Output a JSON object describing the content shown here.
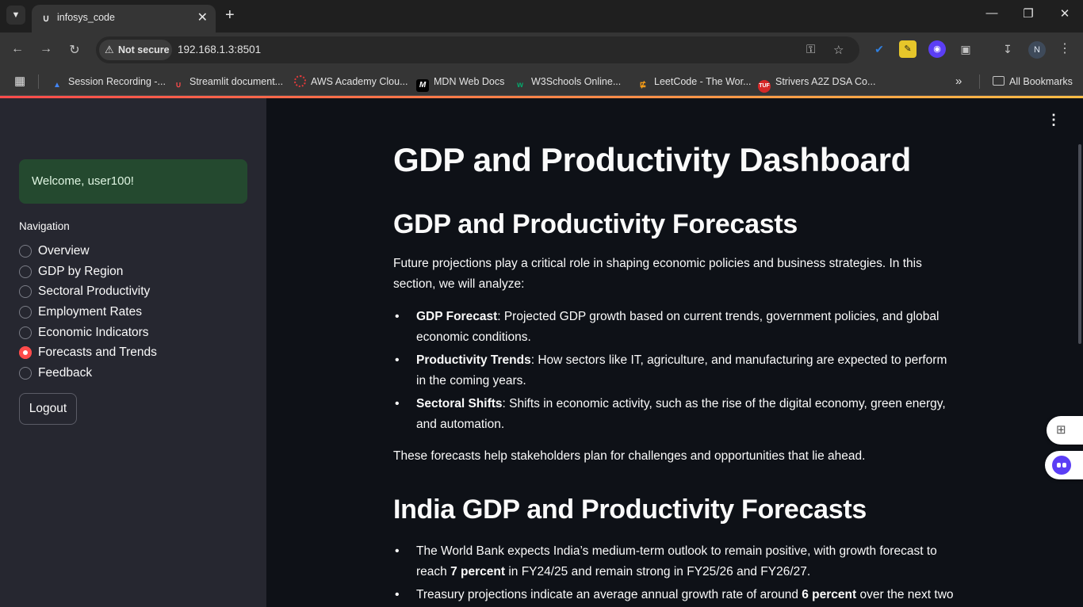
{
  "browser": {
    "tab_title": "infosys_code",
    "security_label": "Not secure",
    "url": "192.168.1.3:8501",
    "profile_initial": "N",
    "bookmarks": [
      {
        "label": "Session Recording -...",
        "icon": "google-drive-icon",
        "color": "#4285f4"
      },
      {
        "label": "Streamlit document...",
        "icon": "streamlit-icon",
        "color": "#ff4b4b"
      },
      {
        "label": "AWS Academy Clou...",
        "icon": "aws-icon",
        "color": "#e23a3a"
      },
      {
        "label": "MDN Web Docs",
        "icon": "mdn-icon",
        "color": "#ffffff"
      },
      {
        "label": "W3Schools Online...",
        "icon": "w3schools-icon",
        "color": "#04aa6d"
      },
      {
        "label": "LeetCode - The Wor...",
        "icon": "leetcode-icon",
        "color": "#ffa116"
      },
      {
        "label": "Strivers A2Z DSA Co...",
        "icon": "tuf-icon",
        "color": "#d62828"
      }
    ],
    "all_bookmarks_label": "All Bookmarks"
  },
  "sidebar": {
    "welcome": "Welcome, user100!",
    "nav_label": "Navigation",
    "items": [
      {
        "label": "Overview",
        "selected": false
      },
      {
        "label": "GDP by Region",
        "selected": false
      },
      {
        "label": "Sectoral Productivity",
        "selected": false
      },
      {
        "label": "Employment Rates",
        "selected": false
      },
      {
        "label": "Economic Indicators",
        "selected": false
      },
      {
        "label": "Forecasts and Trends",
        "selected": true
      },
      {
        "label": "Feedback",
        "selected": false
      }
    ],
    "logout_label": "Logout",
    "accent_color": "#ff4b4b"
  },
  "main": {
    "title": "GDP and Productivity Dashboard",
    "section1": {
      "heading": "GDP and Productivity Forecasts",
      "intro": "Future projections play a critical role in shaping economic policies and business strategies. In this section, we will analyze:",
      "bullets": [
        {
          "term": "GDP Forecast",
          "text": ": Projected GDP growth based on current trends, government policies, and global economic conditions."
        },
        {
          "term": "Productivity Trends",
          "text": ": How sectors like IT, agriculture, and manufacturing are expected to perform in the coming years."
        },
        {
          "term": "Sectoral Shifts",
          "text": ": Shifts in economic activity, such as the rise of the digital economy, green energy, and automation."
        }
      ],
      "outro": "These forecasts help stakeholders plan for challenges and opportunities that lie ahead."
    },
    "section2": {
      "heading": "India GDP and Productivity Forecasts",
      "bullets": [
        {
          "pre": "The World Bank expects India’s medium-term outlook to remain positive, with growth forecast to reach ",
          "bold": "7 percent",
          "post": " in FY24/25 and remain strong in FY25/26 and FY26/27."
        },
        {
          "pre": "Treasury projections indicate an average annual growth rate of around ",
          "bold": "6 percent",
          "post": " over the next two"
        }
      ]
    }
  }
}
